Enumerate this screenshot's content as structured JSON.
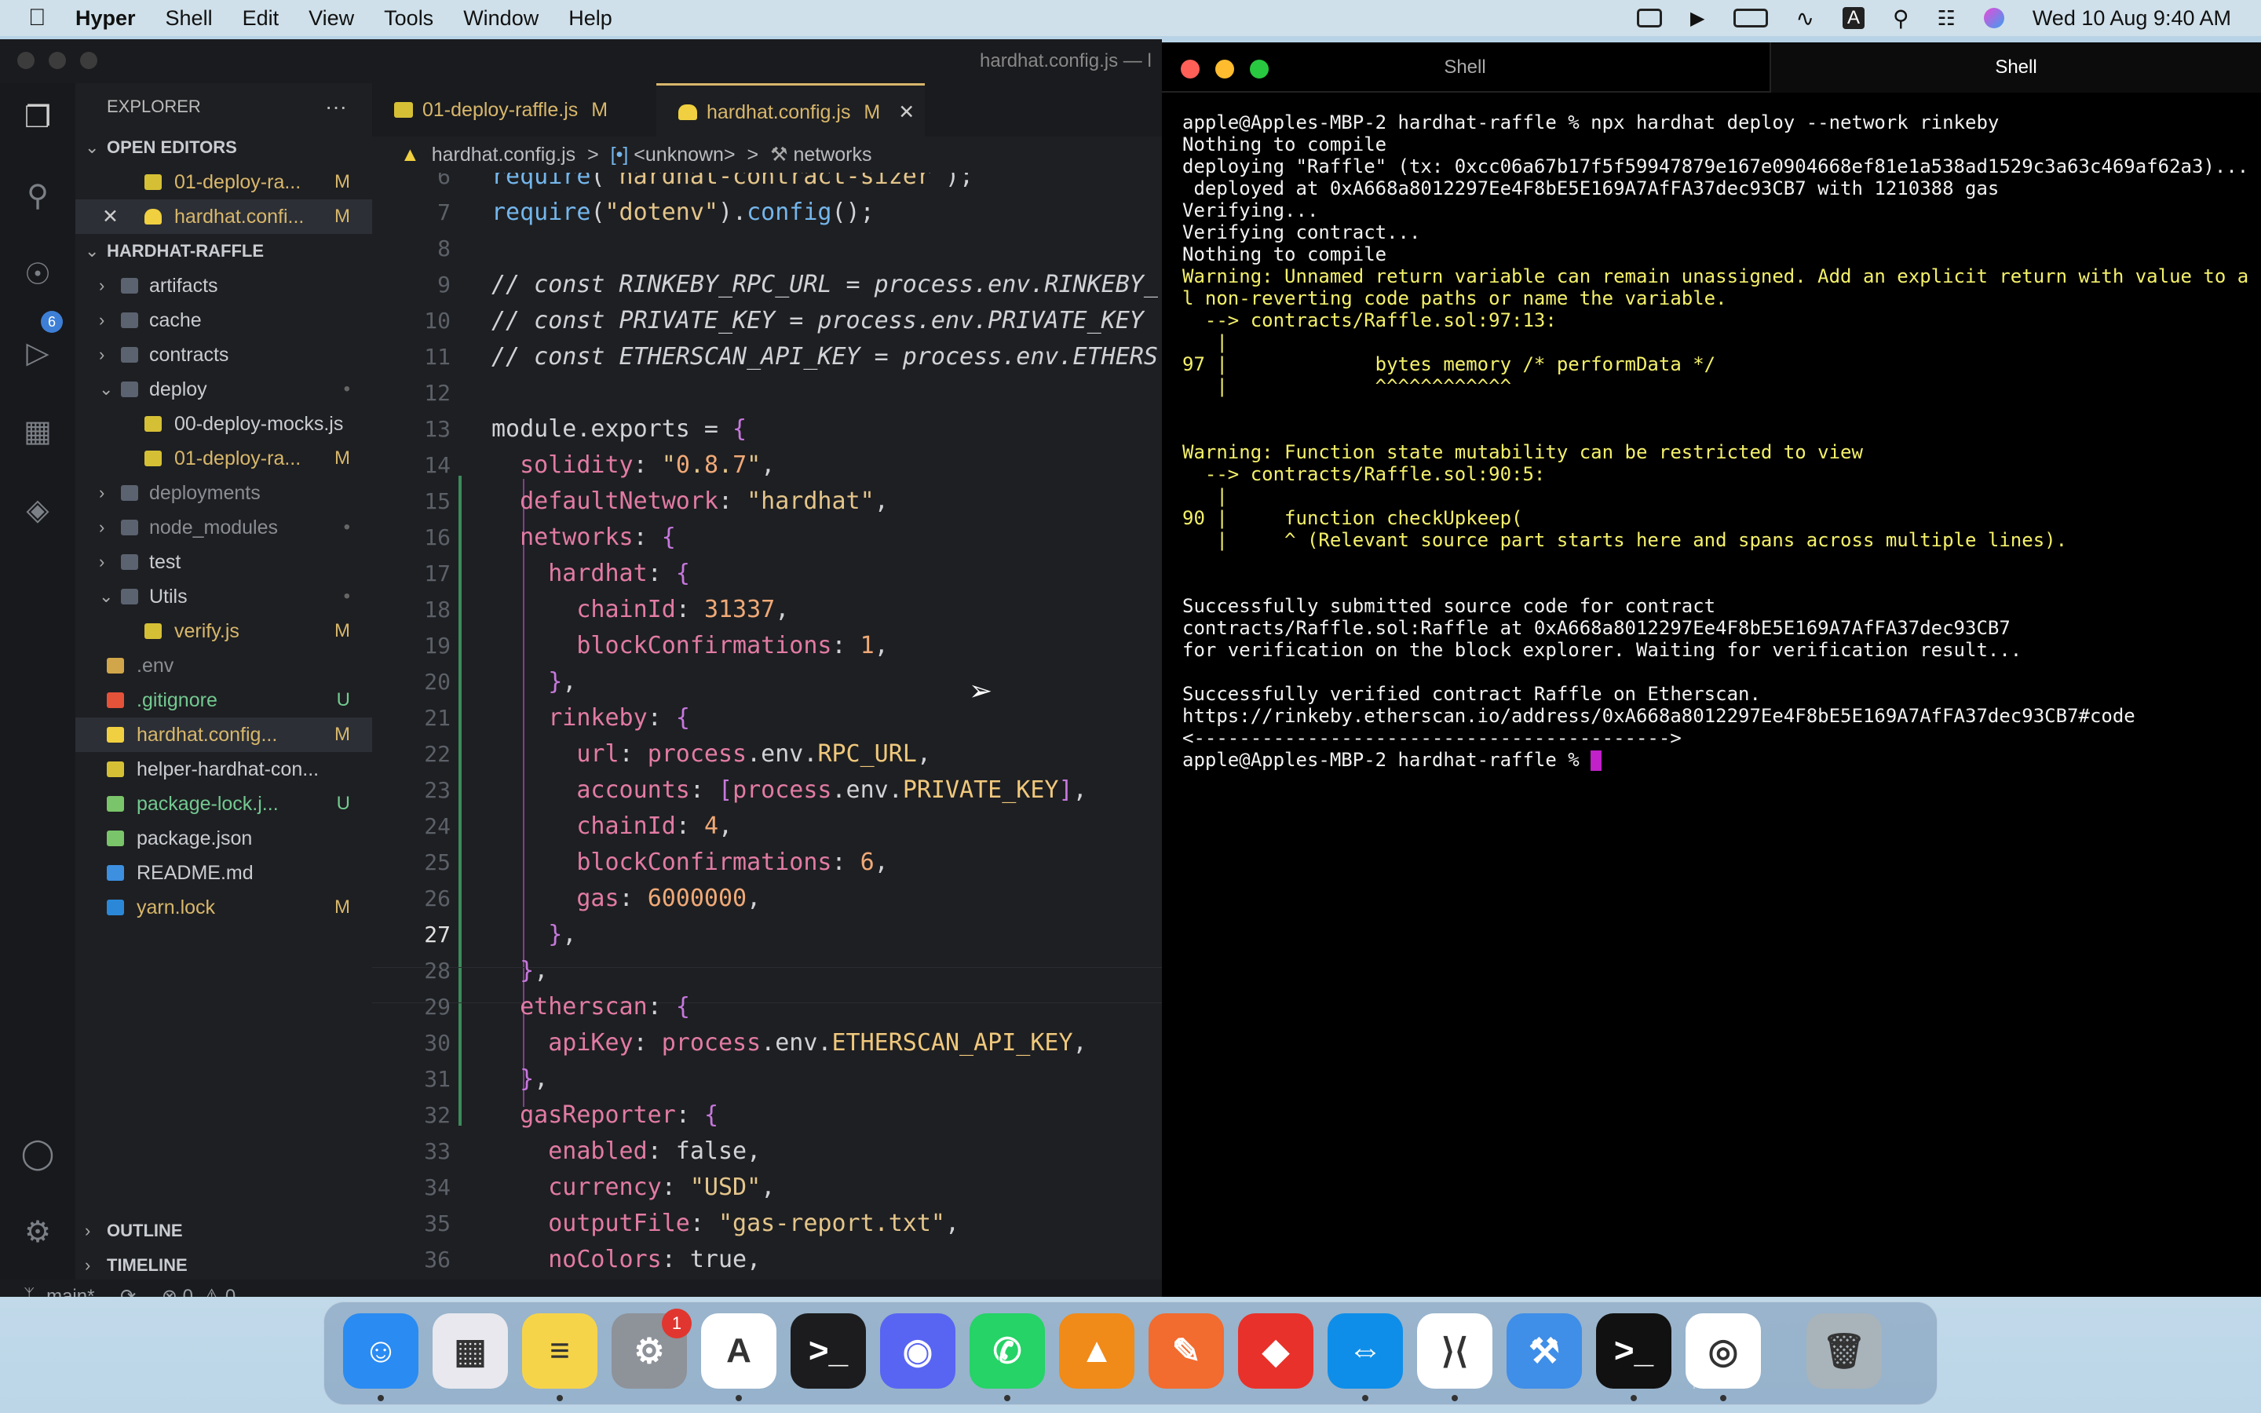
{
  "menubar": {
    "app_name": "Hyper",
    "menus": [
      "Shell",
      "Edit",
      "View",
      "Tools",
      "Window",
      "Help"
    ],
    "clock": "Wed 10 Aug  9:40 AM",
    "input_indicator": "A"
  },
  "vscode": {
    "window_title": "hardhat.config.js — l",
    "explorer_title": "EXPLORER",
    "explorer_more": "···",
    "source_control_badge": "6",
    "open_editors_label": "OPEN EDITORS",
    "open_editors": [
      {
        "name": "01-deploy-ra...",
        "status": "M"
      },
      {
        "name": "hardhat.confi...",
        "status": "M",
        "close": "✕"
      }
    ],
    "project_label": "HARDHAT-RAFFLE",
    "tree": [
      {
        "name": "artifacts",
        "status": "",
        "kind": "folder"
      },
      {
        "name": "cache",
        "status": "",
        "kind": "folder"
      },
      {
        "name": "contracts",
        "status": "",
        "kind": "folder"
      },
      {
        "name": "deploy",
        "status": "•",
        "kind": "folder-open"
      },
      {
        "name": "00-deploy-mocks.js",
        "status": "",
        "kind": "js"
      },
      {
        "name": "01-deploy-ra...",
        "status": "M",
        "kind": "js"
      },
      {
        "name": "deployments",
        "status": "",
        "kind": "folder"
      },
      {
        "name": "node_modules",
        "status": "•",
        "kind": "folder"
      },
      {
        "name": "test",
        "status": "",
        "kind": "folder"
      },
      {
        "name": "Utils",
        "status": "•",
        "kind": "folder-open"
      },
      {
        "name": "verify.js",
        "status": "M",
        "kind": "js"
      },
      {
        "name": ".env",
        "status": "",
        "kind": "env"
      },
      {
        "name": ".gitignore",
        "status": "U",
        "kind": "git"
      },
      {
        "name": "hardhat.config...",
        "status": "M",
        "kind": "hardhat"
      },
      {
        "name": "helper-hardhat-con...",
        "status": "",
        "kind": "js"
      },
      {
        "name": "package-lock.j...",
        "status": "U",
        "kind": "npm"
      },
      {
        "name": "package.json",
        "status": "",
        "kind": "npm"
      },
      {
        "name": "README.md",
        "status": "",
        "kind": "info"
      },
      {
        "name": "yarn.lock",
        "status": "M",
        "kind": "yarn"
      }
    ],
    "outline_label": "OUTLINE",
    "timeline_label": "TIMELINE",
    "tabs": [
      {
        "label": "01-deploy-raffle.js",
        "status": "M"
      },
      {
        "label": "hardhat.config.js",
        "status": "M",
        "close": "✕"
      }
    ],
    "breadcrumb": {
      "file": "hardhat.config.js",
      "sep": ">",
      "scope": "<unknown>",
      "leaf": "networks"
    },
    "status": {
      "branch": "main*",
      "errors": "0",
      "warnings": "0"
    }
  },
  "code_lines": [
    {
      "n": "6",
      "t": "require(\"hardhat-contract-sizer\");"
    },
    {
      "n": "7",
      "t": "require(\"dotenv\").config();"
    },
    {
      "n": "8",
      "t": ""
    },
    {
      "n": "9",
      "t": "// const RINKEBY_RPC_URL = process.env.RINKEBY_"
    },
    {
      "n": "10",
      "t": "// const PRIVATE_KEY = process.env.PRIVATE_KEY"
    },
    {
      "n": "11",
      "t": "// const ETHERSCAN_API_KEY = process.env.ETHERS"
    },
    {
      "n": "12",
      "t": ""
    },
    {
      "n": "13",
      "t": "module.exports = {"
    },
    {
      "n": "14",
      "t": "  solidity: \"0.8.7\","
    },
    {
      "n": "15",
      "t": "  defaultNetwork: \"hardhat\","
    },
    {
      "n": "16",
      "t": "  networks: {"
    },
    {
      "n": "17",
      "t": "    hardhat: {"
    },
    {
      "n": "18",
      "t": "      chainId: 31337,"
    },
    {
      "n": "19",
      "t": "      blockConfirmations: 1,"
    },
    {
      "n": "20",
      "t": "    },"
    },
    {
      "n": "21",
      "t": "    rinkeby: {"
    },
    {
      "n": "22",
      "t": "      url: process.env.RPC_URL,"
    },
    {
      "n": "23",
      "t": "      accounts: [process.env.PRIVATE_KEY],"
    },
    {
      "n": "24",
      "t": "      chainId: 4,"
    },
    {
      "n": "25",
      "t": "      blockConfirmations: 6,"
    },
    {
      "n": "26",
      "t": "      gas: 6000000,"
    },
    {
      "n": "27",
      "t": "    },"
    },
    {
      "n": "28",
      "t": "  },"
    },
    {
      "n": "29",
      "t": "  etherscan: {"
    },
    {
      "n": "30",
      "t": "    apiKey: process.env.ETHERSCAN_API_KEY,"
    },
    {
      "n": "31",
      "t": "  },"
    },
    {
      "n": "32",
      "t": "  gasReporter: {"
    },
    {
      "n": "33",
      "t": "    enabled: false,"
    },
    {
      "n": "34",
      "t": "    currency: \"USD\","
    },
    {
      "n": "35",
      "t": "    outputFile: \"gas-report.txt\","
    },
    {
      "n": "36",
      "t": "    noColors: true,"
    }
  ],
  "hyper": {
    "tabs": [
      "Shell",
      "Shell"
    ],
    "lines": [
      {
        "t": "apple@Apples-MBP-2 hardhat-raffle % npx hardhat deploy --network rinkeby",
        "c": ""
      },
      {
        "t": "Nothing to compile",
        "c": ""
      },
      {
        "t": "deploying \"Raffle\" (tx: 0xcc06a67b17f5f59947879e167e0904668ef81e1a538ad1529c3a63c469af62a3)...:",
        "c": ""
      },
      {
        "t": " deployed at 0xA668a8012297Ee4F8bE5E169A7AfFA37dec93CB7 with 1210388 gas",
        "c": ""
      },
      {
        "t": "Verifying...",
        "c": ""
      },
      {
        "t": "Verifying contract...",
        "c": ""
      },
      {
        "t": "Nothing to compile",
        "c": ""
      },
      {
        "t": "Warning: Unnamed return variable can remain unassigned. Add an explicit return with value to al",
        "c": "y"
      },
      {
        "t": "l non-reverting code paths or name the variable.",
        "c": "y"
      },
      {
        "t": "  --> contracts/Raffle.sol:97:13:",
        "c": "y"
      },
      {
        "t": "   |",
        "c": "y"
      },
      {
        "t": "97 |             bytes memory /* performData */",
        "c": "y"
      },
      {
        "t": "   |             ^^^^^^^^^^^^",
        "c": "y"
      },
      {
        "t": "",
        "c": ""
      },
      {
        "t": "",
        "c": ""
      },
      {
        "t": "Warning: Function state mutability can be restricted to view",
        "c": "y"
      },
      {
        "t": "  --> contracts/Raffle.sol:90:5:",
        "c": "y"
      },
      {
        "t": "   |",
        "c": "y"
      },
      {
        "t": "90 |     function checkUpkeep(",
        "c": "y"
      },
      {
        "t": "   |     ^ (Relevant source part starts here and spans across multiple lines).",
        "c": "y"
      },
      {
        "t": "",
        "c": ""
      },
      {
        "t": "",
        "c": ""
      },
      {
        "t": "Successfully submitted source code for contract",
        "c": ""
      },
      {
        "t": "contracts/Raffle.sol:Raffle at 0xA668a8012297Ee4F8bE5E169A7AfFA37dec93CB7",
        "c": ""
      },
      {
        "t": "for verification on the block explorer. Waiting for verification result...",
        "c": ""
      },
      {
        "t": "",
        "c": ""
      },
      {
        "t": "Successfully verified contract Raffle on Etherscan.",
        "c": ""
      },
      {
        "t": "https://rinkeby.etherscan.io/address/0xA668a8012297Ee4F8bE5E169A7AfFA37dec93CB7#code",
        "c": ""
      },
      {
        "t": "<------------------------------------------>",
        "c": ""
      }
    ],
    "prompt": "apple@Apples-MBP-2 hardhat-raffle % "
  },
  "dock": {
    "apps": [
      {
        "name": "finder-icon",
        "glyph": "☺",
        "color": "#2a8bf2"
      },
      {
        "name": "launchpad-icon",
        "glyph": "▦",
        "color": "#e8e8ee"
      },
      {
        "name": "notes-icon",
        "glyph": "≡",
        "color": "#f6d44a"
      },
      {
        "name": "system-preferences-icon",
        "glyph": "⚙",
        "color": "#8e9299",
        "badge": "1"
      },
      {
        "name": "app-store-icon",
        "glyph": "A",
        "color": "#ffffff"
      },
      {
        "name": "terminal-icon",
        "glyph": ">_",
        "color": "#1c1c1e"
      },
      {
        "name": "discord-icon",
        "glyph": "◉",
        "color": "#5865f2"
      },
      {
        "name": "whatsapp-icon",
        "glyph": "✆",
        "color": "#25d366"
      },
      {
        "name": "vlc-icon",
        "glyph": "▲",
        "color": "#f08a19"
      },
      {
        "name": "sketchbook-icon",
        "glyph": "✎",
        "color": "#f26b2f"
      },
      {
        "name": "anydesk-icon",
        "glyph": "◆",
        "color": "#e8312a"
      },
      {
        "name": "teamviewer-icon",
        "glyph": "⇔",
        "color": "#0e8ee9"
      },
      {
        "name": "vscode-icon",
        "glyph": "⟩⟨",
        "color": "#ffffff"
      },
      {
        "name": "xcode-icon",
        "glyph": "⚒",
        "color": "#3f8ee8"
      },
      {
        "name": "hyper-icon",
        "glyph": ">_",
        "color": "#111111"
      },
      {
        "name": "chrome-icon",
        "glyph": "◎",
        "color": "#ffffff"
      },
      {
        "name": "trash-icon",
        "glyph": "🗑",
        "color": "#a9b3ba"
      }
    ]
  }
}
